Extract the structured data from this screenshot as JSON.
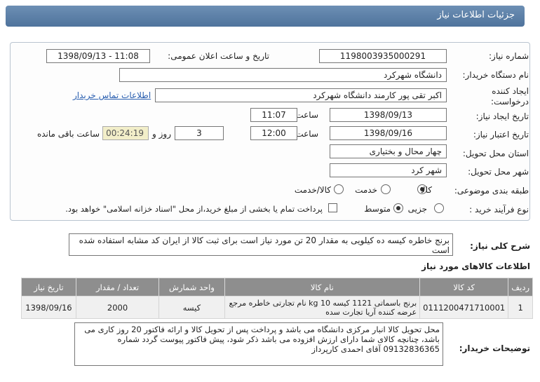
{
  "header": {
    "title": "جزئیات اطلاعات نیاز"
  },
  "fields": {
    "need_number_label": "شماره نیاز:",
    "need_number": "1198003935000291",
    "announce_label": "تاریخ و ساعت اعلان عمومی:",
    "announce_value": "1398/09/13 - 11:08",
    "buyer_org_label": "نام دستگاه خریدار:",
    "buyer_org": "دانشگاه شهرکرد",
    "requester_label_1": "ایجاد کننده",
    "requester_label_2": "درخواست:",
    "requester": "اکبر تقی پور کارمند دانشگاه شهرکرد",
    "contact_link": "اطلاعات تماس خریدار",
    "created_label": "تاریخ ایجاد نیاز:",
    "created_date": "1398/09/13",
    "time_label": "ساعت",
    "created_time": "11:07",
    "valid_label": "تاریخ اعتبار نیاز:",
    "valid_date": "1398/09/16",
    "valid_time": "12:00",
    "days_value": "3",
    "day_and": "روز و",
    "remaining_time": "00:24:19",
    "remaining_label": "ساعت باقی مانده",
    "province_label": "استان محل تحویل:",
    "province": "چهار محال و بختیاری",
    "city_label": "شهر محل تحویل:",
    "city": "شهر کرد",
    "category_label": "طبقه بندی موضوعی:",
    "cat_goods": "کالا",
    "cat_service": "خدمت",
    "cat_goods_service": "کالا/خدمت",
    "process_label": "نوع فرآیند خرید :",
    "proc_partial": "جزیی",
    "proc_medium": "متوسط",
    "payment_note": "پرداخت تمام یا بخشی از مبلغ خرید،از محل \"اسناد خزانه اسلامی\" خواهد بود."
  },
  "summary": {
    "label": "شرح کلی نیاز:",
    "text": "برنج خاطره کیسه ده کیلویی به مقدار 20 تن مورد نیاز است برای ثبت کالا از ایران کد مشابه استفاده شده است"
  },
  "goods": {
    "section_title": "اطلاعات کالاهای مورد نیاز",
    "columns": [
      "ردیف",
      "کد کالا",
      "نام کالا",
      "واحد شمارش",
      "تعداد / مقدار",
      "تاریخ نیاز"
    ],
    "rows": [
      {
        "row": "1",
        "code": "0111200471710001",
        "name": "برنج باسماتی 1121 کیسه 10 kg نام تجارتی خاطره مرجع عرضه کننده آریا تجارت سده",
        "unit": "کیسه",
        "qty": "2000",
        "date": "1398/09/16"
      }
    ]
  },
  "buyer_notes": {
    "label": "توضیحات خریدار:",
    "text": "محل تحویل کالا انبار مرکزی دانشگاه می باشد و پرداخت پس از تحویل کالا و ارائه فاکتور 20 روز کاری می باشد، چنانچه کالای شما دارای ارزش افزوده می باشد  ذکر شود، پیش فاکتور پیوست گردد شماره 09132836365 آقای احمدی کارپرداز"
  },
  "selections": {
    "category": "کالا",
    "process": "متوسط",
    "treasury_checkbox": false
  }
}
